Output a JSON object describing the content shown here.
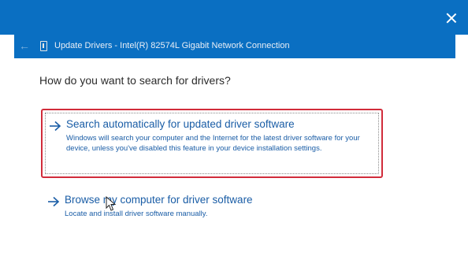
{
  "dialog": {
    "title": "Update Drivers - Intel(R) 82574L Gigabit Network Connection",
    "question": "How do you want to search for drivers?",
    "back_icon": "back-arrow-icon",
    "close_icon": "close-icon",
    "device_icon": "network-adapter-icon",
    "accent_color": "#0a6fc2",
    "highlight_color": "#d12c3b",
    "link_color": "#1a5da6"
  },
  "options": [
    {
      "title": "Search automatically for updated driver software",
      "description": "Windows will search your computer and the Internet for the latest driver software for your device, unless you've disabled this feature in your device installation settings.",
      "icon": "arrow-right-icon",
      "highlighted": true
    },
    {
      "title": "Browse my computer for driver software",
      "description": "Locate and install driver software manually.",
      "icon": "arrow-right-icon",
      "highlighted": false
    }
  ]
}
